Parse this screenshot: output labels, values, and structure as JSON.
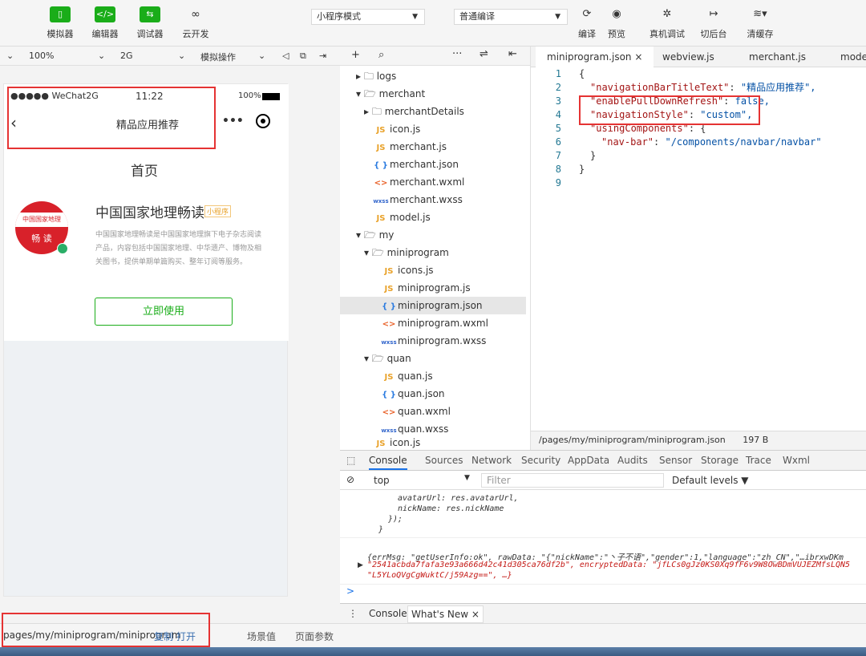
{
  "toolbar": {
    "simulator": "模拟器",
    "editor": "编辑器",
    "debugger": "调试器",
    "cloud": "云开发",
    "mode_select": "小程序模式",
    "compile_select": "普通编译",
    "compile": "编译",
    "preview": "预览",
    "real_debug": "真机调试",
    "background": "切后台",
    "clear_cache": "清缓存"
  },
  "subbar": {
    "zoom": "100%",
    "network": "2G",
    "simulate_op": "模拟操作"
  },
  "phone": {
    "carrier": "●●●●● WeChat2G",
    "time": "11:22",
    "battery": "100%",
    "nav_title": "精品应用推荐",
    "page_title": "首页",
    "app_name": "中国国家地理畅读",
    "app_badge": "小程序",
    "app_desc": "中国国家地理畅读是中国国家地理旗下电子杂志阅读产品，内容包括中国国家地理、中华遗产、博物及相关图书，提供单期单篇购买、整年订阅等服务。",
    "logo_text_top": "中国国家地理",
    "logo_text_bottom": "畅 读",
    "use_button": "立即使用"
  },
  "filetree": {
    "rows": [
      {
        "label": "logs"
      },
      {
        "label": "merchant"
      },
      {
        "label": "merchantDetails"
      },
      {
        "label": "icon.js"
      },
      {
        "label": "merchant.js"
      },
      {
        "label": "merchant.json"
      },
      {
        "label": "merchant.wxml"
      },
      {
        "label": "merchant.wxss"
      },
      {
        "label": "model.js"
      },
      {
        "label": "my"
      },
      {
        "label": "miniprogram"
      },
      {
        "label": "icons.js"
      },
      {
        "label": "miniprogram.js"
      },
      {
        "label": "miniprogram.json"
      },
      {
        "label": "miniprogram.wxml"
      },
      {
        "label": "miniprogram.wxss"
      },
      {
        "label": "quan"
      },
      {
        "label": "quan.js"
      },
      {
        "label": "quan.json"
      },
      {
        "label": "quan.wxml"
      },
      {
        "label": "quan.wxss"
      },
      {
        "label": "icon.js"
      }
    ]
  },
  "editor": {
    "tabs": [
      "miniprogram.json ×",
      "webview.js",
      "merchant.js",
      "model"
    ],
    "lines": [
      {
        "n": "1",
        "t": "{"
      },
      {
        "n": "2",
        "k": "\"navigationBarTitleText\"",
        "v": "\"精品应用推荐\","
      },
      {
        "n": "3",
        "k": "\"enablePullDownRefresh\"",
        "v": "false,"
      },
      {
        "n": "4",
        "k": "\"navigationStyle\"",
        "v": "\"custom\","
      },
      {
        "n": "5",
        "k": "\"usingComponents\"",
        "v": "{"
      },
      {
        "n": "6",
        "k": "\"nav-bar\"",
        "v": "\"/components/navbar/navbar\""
      },
      {
        "n": "7",
        "t": "}"
      },
      {
        "n": "8",
        "t": "}"
      },
      {
        "n": "9",
        "t": ""
      }
    ],
    "status_path": "/pages/my/miniprogram/miniprogram.json",
    "status_size": "197 B"
  },
  "devtools": {
    "tabs": [
      "Console",
      "Sources",
      "Network",
      "Security",
      "AppData",
      "Audits",
      "Sensor",
      "Storage",
      "Trace",
      "Wxml"
    ],
    "context": "top",
    "filter_placeholder": "Filter",
    "levels": "Default levels ▼",
    "code1": "avatarUrl: res.avatarUrl,",
    "code2": "nickName: res.nickName",
    "code3": "});",
    "code4": "}",
    "log1": "{errMsg: \"getUserInfo:ok\", rawData: \"{\"nickName\":\"丶子不语\",\"gender\":1,\"language\":\"zh_CN\",\"…ibrxwDKm",
    "log2": "\"2541acbda7fafa3e93a666d42c41d305ca76df2b\", encryptedData: \"jfLCs0gJz0KS0Xq9fF6v9W8OwBDmVUJEZMfsLQN5",
    "log3": "\"L5YLoQVgCgWuktC/j59Azg==\", …}",
    "prompt": ">",
    "drawer_console": "Console",
    "drawer_whatsnew": "What's New ×"
  },
  "bottombar": {
    "path": "pages/my/miniprogram/miniprogram",
    "copy": "复制",
    "open": "打开",
    "scene": "场景值",
    "params": "页面参数"
  },
  "colors": {
    "accent": "#1aad19",
    "highlight": "#e53333"
  }
}
